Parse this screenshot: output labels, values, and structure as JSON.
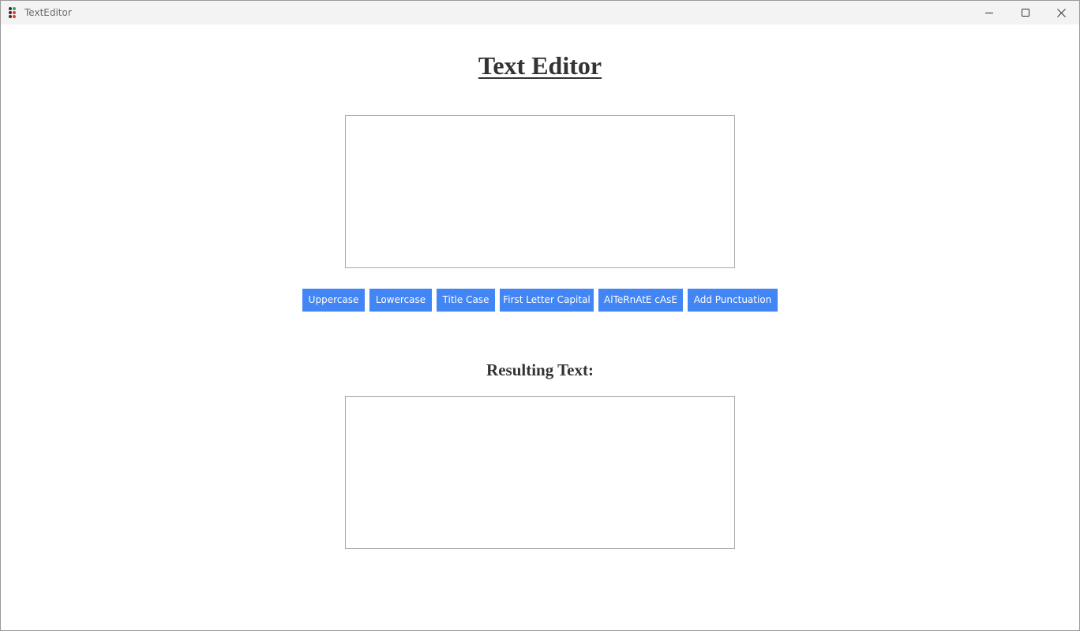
{
  "window": {
    "title": "TextEditor",
    "icon": "app-dots-icon",
    "controls": {
      "minimize_icon": "minimize-icon",
      "maximize_icon": "maximize-icon",
      "close_icon": "close-icon"
    }
  },
  "main": {
    "heading": "Text Editor",
    "input": {
      "value": "",
      "placeholder": ""
    },
    "buttons": [
      {
        "label": "Uppercase"
      },
      {
        "label": "Lowercase"
      },
      {
        "label": "Title Case"
      },
      {
        "label": "First Letter Capital"
      },
      {
        "label": "AlTeRnAtE cAsE"
      },
      {
        "label": "Add Punctuation"
      }
    ],
    "result_heading": "Resulting Text:",
    "output": {
      "value": ""
    }
  },
  "colors": {
    "button_bg": "#4285f4",
    "button_text": "#ffffff",
    "heading_text": "#333333",
    "titlebar_bg": "#f3f3f3",
    "textbox_border": "#a9a9a9"
  }
}
